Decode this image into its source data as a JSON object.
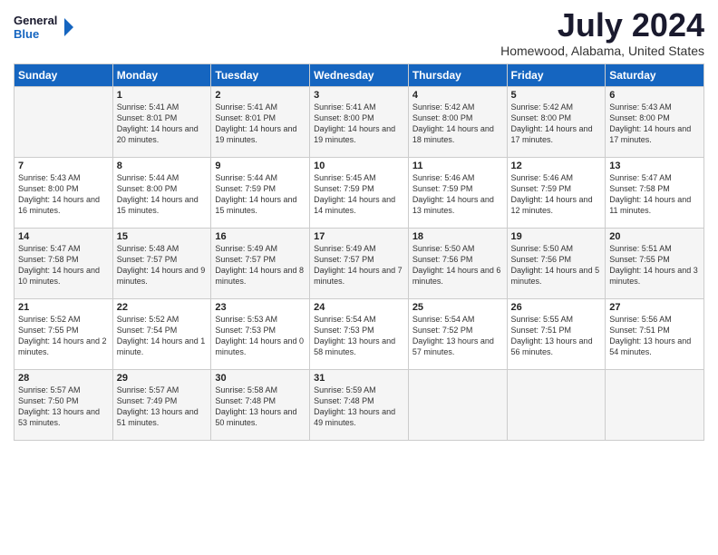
{
  "header": {
    "logo_line1": "General",
    "logo_line2": "Blue",
    "month_year": "July 2024",
    "location": "Homewood, Alabama, United States"
  },
  "days_of_week": [
    "Sunday",
    "Monday",
    "Tuesday",
    "Wednesday",
    "Thursday",
    "Friday",
    "Saturday"
  ],
  "weeks": [
    [
      {
        "day": "",
        "sunrise": "",
        "sunset": "",
        "daylight": ""
      },
      {
        "day": "1",
        "sunrise": "Sunrise: 5:41 AM",
        "sunset": "Sunset: 8:01 PM",
        "daylight": "Daylight: 14 hours and 20 minutes."
      },
      {
        "day": "2",
        "sunrise": "Sunrise: 5:41 AM",
        "sunset": "Sunset: 8:01 PM",
        "daylight": "Daylight: 14 hours and 19 minutes."
      },
      {
        "day": "3",
        "sunrise": "Sunrise: 5:41 AM",
        "sunset": "Sunset: 8:00 PM",
        "daylight": "Daylight: 14 hours and 19 minutes."
      },
      {
        "day": "4",
        "sunrise": "Sunrise: 5:42 AM",
        "sunset": "Sunset: 8:00 PM",
        "daylight": "Daylight: 14 hours and 18 minutes."
      },
      {
        "day": "5",
        "sunrise": "Sunrise: 5:42 AM",
        "sunset": "Sunset: 8:00 PM",
        "daylight": "Daylight: 14 hours and 17 minutes."
      },
      {
        "day": "6",
        "sunrise": "Sunrise: 5:43 AM",
        "sunset": "Sunset: 8:00 PM",
        "daylight": "Daylight: 14 hours and 17 minutes."
      }
    ],
    [
      {
        "day": "7",
        "sunrise": "Sunrise: 5:43 AM",
        "sunset": "Sunset: 8:00 PM",
        "daylight": "Daylight: 14 hours and 16 minutes."
      },
      {
        "day": "8",
        "sunrise": "Sunrise: 5:44 AM",
        "sunset": "Sunset: 8:00 PM",
        "daylight": "Daylight: 14 hours and 15 minutes."
      },
      {
        "day": "9",
        "sunrise": "Sunrise: 5:44 AM",
        "sunset": "Sunset: 7:59 PM",
        "daylight": "Daylight: 14 hours and 15 minutes."
      },
      {
        "day": "10",
        "sunrise": "Sunrise: 5:45 AM",
        "sunset": "Sunset: 7:59 PM",
        "daylight": "Daylight: 14 hours and 14 minutes."
      },
      {
        "day": "11",
        "sunrise": "Sunrise: 5:46 AM",
        "sunset": "Sunset: 7:59 PM",
        "daylight": "Daylight: 14 hours and 13 minutes."
      },
      {
        "day": "12",
        "sunrise": "Sunrise: 5:46 AM",
        "sunset": "Sunset: 7:59 PM",
        "daylight": "Daylight: 14 hours and 12 minutes."
      },
      {
        "day": "13",
        "sunrise": "Sunrise: 5:47 AM",
        "sunset": "Sunset: 7:58 PM",
        "daylight": "Daylight: 14 hours and 11 minutes."
      }
    ],
    [
      {
        "day": "14",
        "sunrise": "Sunrise: 5:47 AM",
        "sunset": "Sunset: 7:58 PM",
        "daylight": "Daylight: 14 hours and 10 minutes."
      },
      {
        "day": "15",
        "sunrise": "Sunrise: 5:48 AM",
        "sunset": "Sunset: 7:57 PM",
        "daylight": "Daylight: 14 hours and 9 minutes."
      },
      {
        "day": "16",
        "sunrise": "Sunrise: 5:49 AM",
        "sunset": "Sunset: 7:57 PM",
        "daylight": "Daylight: 14 hours and 8 minutes."
      },
      {
        "day": "17",
        "sunrise": "Sunrise: 5:49 AM",
        "sunset": "Sunset: 7:57 PM",
        "daylight": "Daylight: 14 hours and 7 minutes."
      },
      {
        "day": "18",
        "sunrise": "Sunrise: 5:50 AM",
        "sunset": "Sunset: 7:56 PM",
        "daylight": "Daylight: 14 hours and 6 minutes."
      },
      {
        "day": "19",
        "sunrise": "Sunrise: 5:50 AM",
        "sunset": "Sunset: 7:56 PM",
        "daylight": "Daylight: 14 hours and 5 minutes."
      },
      {
        "day": "20",
        "sunrise": "Sunrise: 5:51 AM",
        "sunset": "Sunset: 7:55 PM",
        "daylight": "Daylight: 14 hours and 3 minutes."
      }
    ],
    [
      {
        "day": "21",
        "sunrise": "Sunrise: 5:52 AM",
        "sunset": "Sunset: 7:55 PM",
        "daylight": "Daylight: 14 hours and 2 minutes."
      },
      {
        "day": "22",
        "sunrise": "Sunrise: 5:52 AM",
        "sunset": "Sunset: 7:54 PM",
        "daylight": "Daylight: 14 hours and 1 minute."
      },
      {
        "day": "23",
        "sunrise": "Sunrise: 5:53 AM",
        "sunset": "Sunset: 7:53 PM",
        "daylight": "Daylight: 14 hours and 0 minutes."
      },
      {
        "day": "24",
        "sunrise": "Sunrise: 5:54 AM",
        "sunset": "Sunset: 7:53 PM",
        "daylight": "Daylight: 13 hours and 58 minutes."
      },
      {
        "day": "25",
        "sunrise": "Sunrise: 5:54 AM",
        "sunset": "Sunset: 7:52 PM",
        "daylight": "Daylight: 13 hours and 57 minutes."
      },
      {
        "day": "26",
        "sunrise": "Sunrise: 5:55 AM",
        "sunset": "Sunset: 7:51 PM",
        "daylight": "Daylight: 13 hours and 56 minutes."
      },
      {
        "day": "27",
        "sunrise": "Sunrise: 5:56 AM",
        "sunset": "Sunset: 7:51 PM",
        "daylight": "Daylight: 13 hours and 54 minutes."
      }
    ],
    [
      {
        "day": "28",
        "sunrise": "Sunrise: 5:57 AM",
        "sunset": "Sunset: 7:50 PM",
        "daylight": "Daylight: 13 hours and 53 minutes."
      },
      {
        "day": "29",
        "sunrise": "Sunrise: 5:57 AM",
        "sunset": "Sunset: 7:49 PM",
        "daylight": "Daylight: 13 hours and 51 minutes."
      },
      {
        "day": "30",
        "sunrise": "Sunrise: 5:58 AM",
        "sunset": "Sunset: 7:48 PM",
        "daylight": "Daylight: 13 hours and 50 minutes."
      },
      {
        "day": "31",
        "sunrise": "Sunrise: 5:59 AM",
        "sunset": "Sunset: 7:48 PM",
        "daylight": "Daylight: 13 hours and 49 minutes."
      },
      {
        "day": "",
        "sunrise": "",
        "sunset": "",
        "daylight": ""
      },
      {
        "day": "",
        "sunrise": "",
        "sunset": "",
        "daylight": ""
      },
      {
        "day": "",
        "sunrise": "",
        "sunset": "",
        "daylight": ""
      }
    ]
  ]
}
